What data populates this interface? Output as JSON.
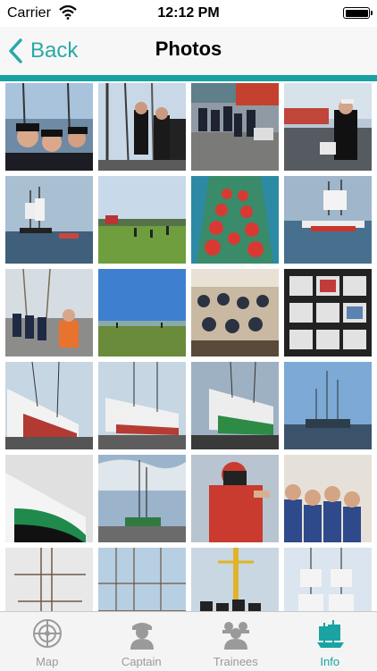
{
  "status_bar": {
    "carrier": "Carrier",
    "time": "12:12 PM"
  },
  "nav": {
    "back_label": "Back",
    "title": "Photos"
  },
  "colors": {
    "accent": "#18a2a2",
    "tab_inactive": "#9a9a9a",
    "nav_bg": "#f7f7f7"
  },
  "tabs": [
    {
      "label": "Map",
      "icon": "radar-icon",
      "active": false
    },
    {
      "label": "Captain",
      "icon": "captain-icon",
      "active": false
    },
    {
      "label": "Trainees",
      "icon": "trainees-icon",
      "active": false
    },
    {
      "label": "Info",
      "icon": "ship-icon",
      "active": true
    }
  ],
  "photos": [
    {
      "subject": "sailors-group"
    },
    {
      "subject": "sailors-rigging"
    },
    {
      "subject": "dock-crowd"
    },
    {
      "subject": "harbor-sailor"
    },
    {
      "subject": "tall-ship-water"
    },
    {
      "subject": "green-field"
    },
    {
      "subject": "red-rowboat"
    },
    {
      "subject": "ship-harbor"
    },
    {
      "subject": "tug-of-war"
    },
    {
      "subject": "meadow-sky"
    },
    {
      "subject": "lecture-room"
    },
    {
      "subject": "photo-collage"
    },
    {
      "subject": "drydock-ship"
    },
    {
      "subject": "drydock-ship"
    },
    {
      "subject": "drydock-green"
    },
    {
      "subject": "mast-harbor"
    },
    {
      "subject": "green-hull"
    },
    {
      "subject": "ship-cloudy"
    },
    {
      "subject": "diver-thumbs-up"
    },
    {
      "subject": "crew-group"
    },
    {
      "subject": "mast-white"
    },
    {
      "subject": "marina"
    },
    {
      "subject": "crew-yellow-mast"
    },
    {
      "subject": "sails-sky"
    }
  ]
}
